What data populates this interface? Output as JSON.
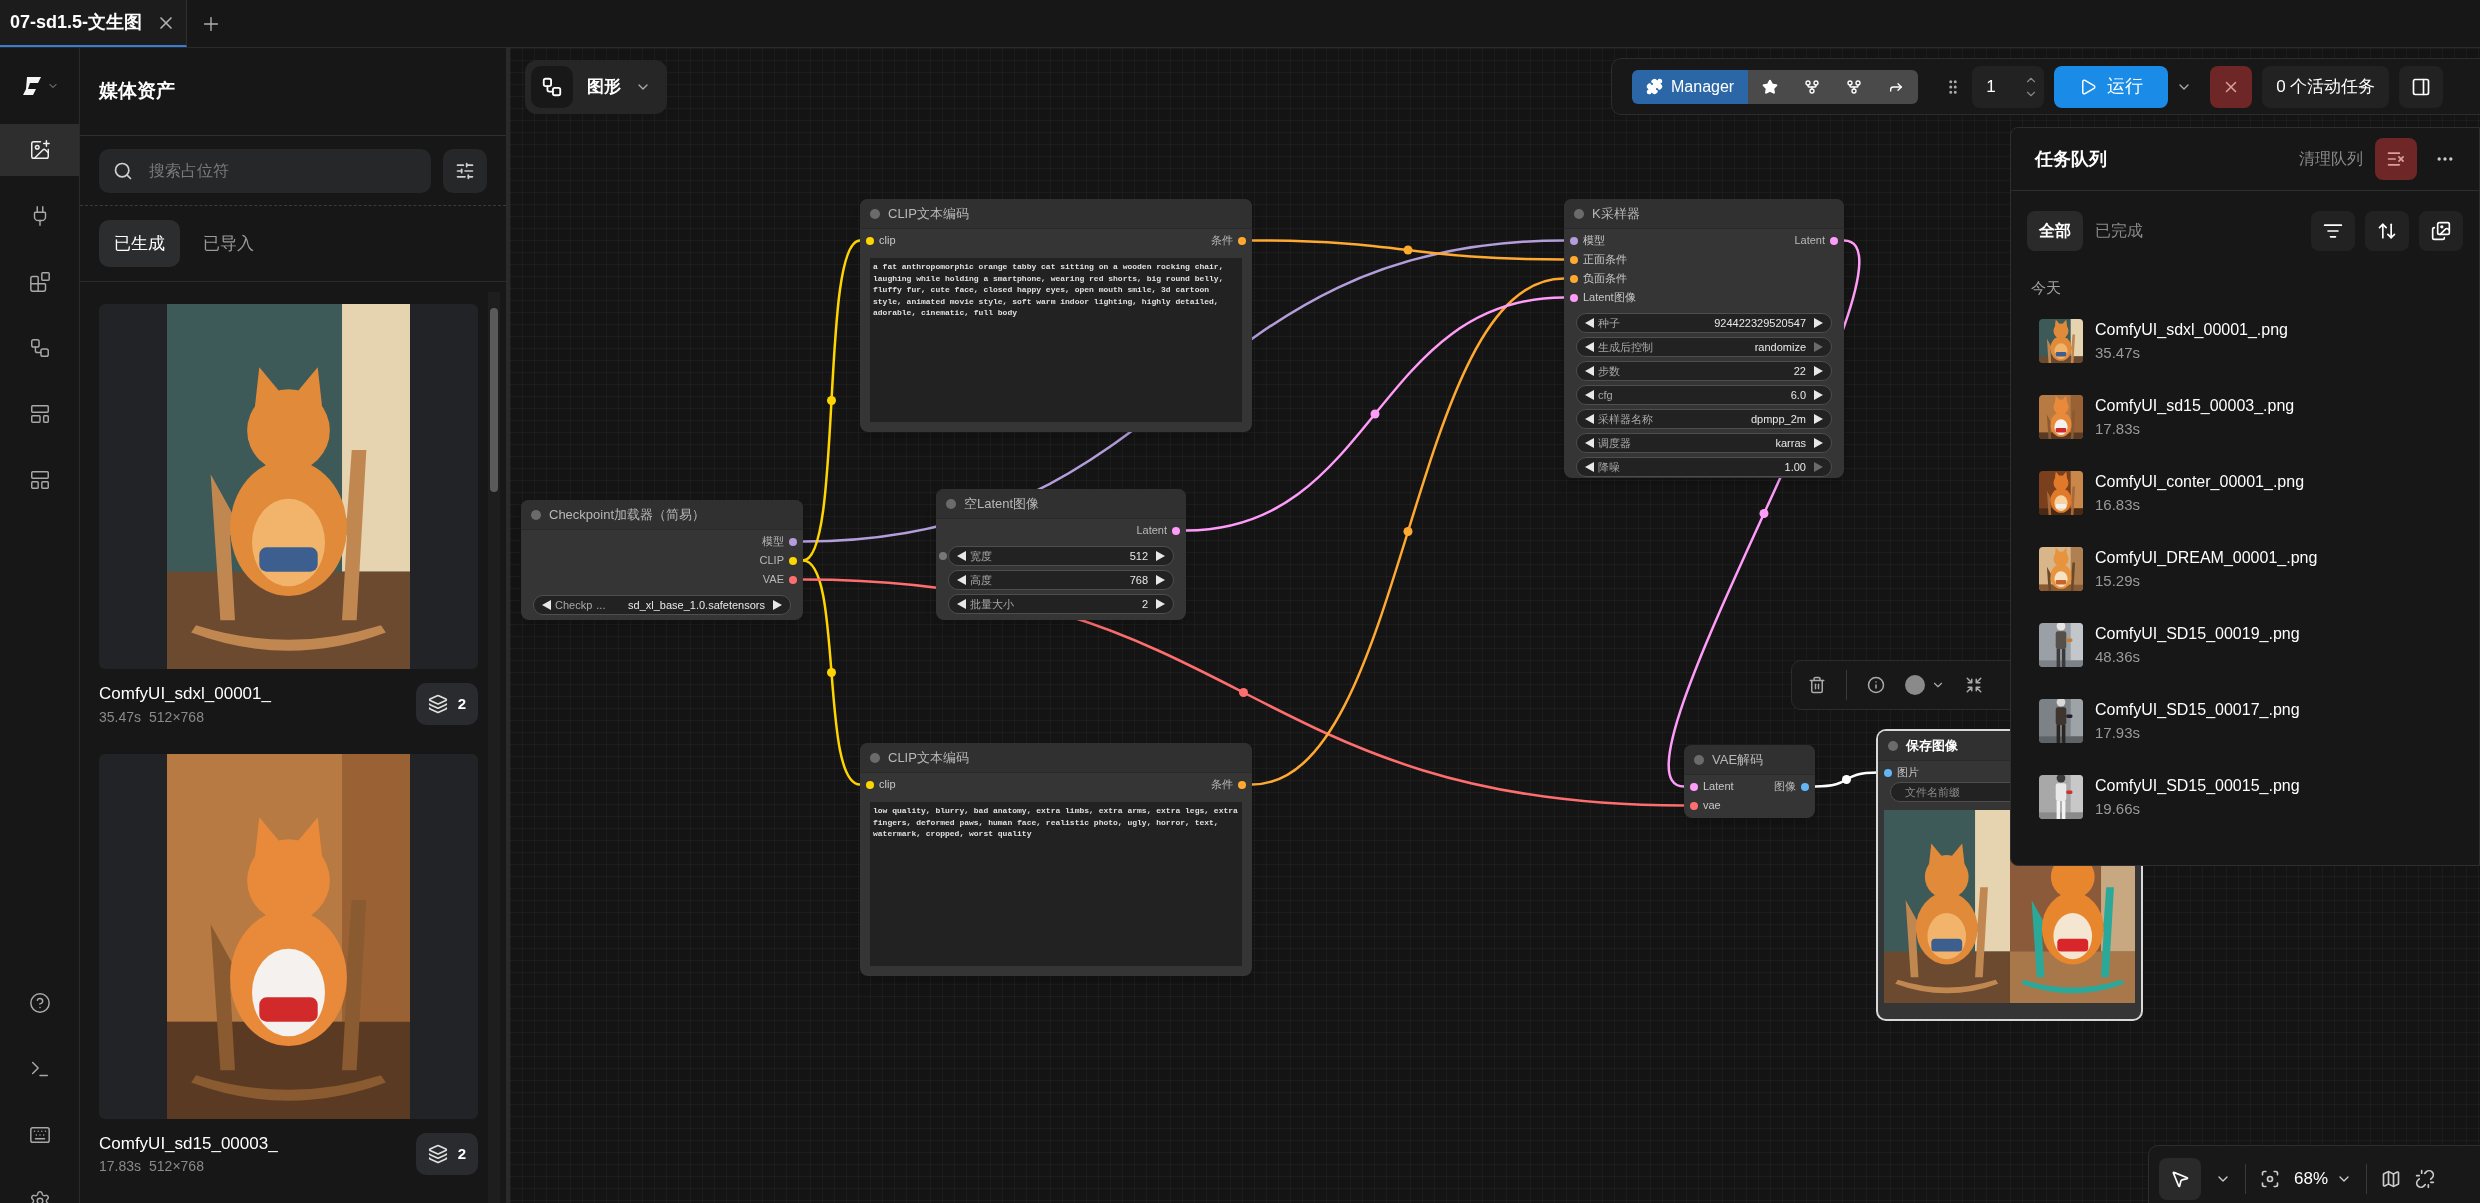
{
  "tabs": [
    {
      "label": "07-sd1.5-文生图",
      "selected": true
    }
  ],
  "rail": {
    "top": [
      {
        "kind": "media",
        "selected": true
      },
      {
        "kind": "nodes",
        "selected": false
      },
      {
        "kind": "models",
        "selected": false
      },
      {
        "kind": "workflows",
        "selected": false
      },
      {
        "kind": "templates",
        "selected": false
      },
      {
        "kind": "layouts",
        "selected": false
      }
    ],
    "bottom": [
      {
        "kind": "help"
      },
      {
        "kind": "terminal"
      },
      {
        "kind": "shortcuts"
      },
      {
        "kind": "settings"
      }
    ]
  },
  "media_panel": {
    "title": "媒体资产",
    "search": {
      "placeholder": "搜索占位符"
    },
    "tabs": [
      {
        "label": "已生成",
        "selected": true
      },
      {
        "label": "已导入",
        "selected": false
      }
    ],
    "items": [
      {
        "name": "ComfyUI_sdxl_00001_",
        "duration": "35.47s",
        "size": "512×768",
        "count": "2"
      },
      {
        "name": "ComfyUI_sd15_00003_",
        "duration": "17.83s",
        "size": "512×768",
        "count": "2"
      }
    ]
  },
  "canvas": {
    "mode_button": "图形",
    "nodes": [
      {
        "title": "CLIP文本编码",
        "selected": false,
        "inputs": [
          {
            "label": "clip",
            "color": "#ffd500"
          }
        ],
        "outputs": [
          {
            "label": "条件",
            "color": "#ffa931"
          }
        ],
        "widgets": [
          {
            "kind": "text",
            "value": "a fat anthropomorphic orange tabby cat sitting on a wooden rocking chair, laughing while holding a smartphone, wearing red shorts, big round belly, fluffy fur, cute face, closed happy eyes, open mouth smile, 3d cartoon style, animated movie style, soft warm indoor lighting, highly detailed, adorable, cinematic, full body"
          }
        ]
      },
      {
        "title": "Checkpoint加载器（简易）",
        "selected": false,
        "outputs": [
          {
            "label": "模型",
            "color": "#b39ddb"
          },
          {
            "label": "CLIP",
            "color": "#ffd500"
          },
          {
            "label": "VAE",
            "color": "#ff6e6e"
          }
        ],
        "widgets": [
          {
            "kind": "value",
            "label": "Checkp",
            "elided": "...",
            "value": "sd_xl_base_1.0.safetensors",
            "right_disabled": false
          }
        ]
      },
      {
        "title": "空Latent图像",
        "selected": false,
        "outputs": [
          {
            "label": "Latent",
            "color": "#ff9cf9"
          }
        ],
        "widgets": [
          {
            "kind": "value",
            "label": "宽度",
            "value": "512",
            "right_disabled": false,
            "linked_input": true
          },
          {
            "kind": "value",
            "label": "高度",
            "value": "768",
            "right_disabled": false
          },
          {
            "kind": "value",
            "label": "批量大小",
            "value": "2",
            "right_disabled": false
          }
        ]
      },
      {
        "title": "K采样器",
        "selected": false,
        "inputs": [
          {
            "label": "模型",
            "color": "#b39ddb"
          },
          {
            "label": "正面条件",
            "color": "#ffa931"
          },
          {
            "label": "负面条件",
            "color": "#ffa931"
          },
          {
            "label": "Latent图像",
            "color": "#ff9cf9"
          }
        ],
        "outputs": [
          {
            "label": "Latent",
            "color": "#ff9cf9"
          }
        ],
        "widgets": [
          {
            "kind": "value",
            "label": "种子",
            "value": "924422329520547",
            "right_disabled": false
          },
          {
            "kind": "value",
            "label": "生成后控制",
            "value": "randomize",
            "right_disabled": true
          },
          {
            "kind": "value",
            "label": "步数",
            "value": "22",
            "right_disabled": false
          },
          {
            "kind": "value",
            "label": "cfg",
            "value": "6.0",
            "right_disabled": false
          },
          {
            "kind": "value",
            "label": "采样器名称",
            "value": "dpmpp_2m",
            "right_disabled": false
          },
          {
            "kind": "value",
            "label": "调度器",
            "value": "karras",
            "right_disabled": false
          },
          {
            "kind": "value",
            "label": "降噪",
            "value": "1.00",
            "right_disabled": true
          }
        ]
      },
      {
        "title": "CLIP文本编码",
        "selected": false,
        "inputs": [
          {
            "label": "clip",
            "color": "#ffd500"
          }
        ],
        "outputs": [
          {
            "label": "条件",
            "color": "#ffa931"
          }
        ],
        "widgets": [
          {
            "kind": "text",
            "value": "low quality, blurry, bad anatomy, extra limbs, extra arms, extra legs, extra fingers, deformed paws, human face, realistic photo, ugly, horror, text, watermark, cropped, worst quality"
          }
        ]
      },
      {
        "title": "VAE解码",
        "selected": false,
        "inputs": [
          {
            "label": "Latent",
            "color": "#ff9cf9"
          },
          {
            "label": "vae",
            "color": "#ff6e6e"
          }
        ],
        "outputs": [
          {
            "label": "图像",
            "color": "#64b5f6"
          }
        ]
      },
      {
        "title": "保存图像",
        "selected": true,
        "inputs": [
          {
            "label": "图片",
            "color": "#64b5f6"
          }
        ],
        "widgets": [
          {
            "kind": "field",
            "placeholder": "文件名前缀"
          },
          {
            "kind": "preview"
          }
        ]
      }
    ],
    "links": [
      {
        "color": "#b39ddb"
      },
      {
        "color": "#ffd500"
      },
      {
        "color": "#ffd500"
      },
      {
        "color": "#ff6e6e"
      },
      {
        "color": "#ffa931"
      },
      {
        "color": "#ffa931"
      },
      {
        "color": "#ff9cf9"
      },
      {
        "color": "#ff9cf9"
      },
      {
        "color": "#ffffff"
      }
    ]
  },
  "toolbar": {
    "manager": "Manager",
    "batch_count": "1",
    "run": "运行",
    "active_tasks": "0 个活动任务"
  },
  "queue": {
    "title": "任务队列",
    "clear": "清理队列",
    "tabs": [
      {
        "label": "全部",
        "selected": true
      },
      {
        "label": "已完成",
        "selected": false
      }
    ],
    "section": "今天",
    "items": [
      {
        "name": "ComfyUI_sdxl_00001_.png",
        "time": "35.47s"
      },
      {
        "name": "ComfyUI_sd15_00003_.png",
        "time": "17.83s"
      },
      {
        "name": "ComfyUI_conter_00001_.png",
        "time": "16.83s"
      },
      {
        "name": "ComfyUI_DREAM_00001_.png",
        "time": "15.29s"
      },
      {
        "name": "ComfyUI_SD15_00019_.png",
        "time": "48.36s"
      },
      {
        "name": "ComfyUI_SD15_00017_.png",
        "time": "17.93s"
      },
      {
        "name": "ComfyUI_SD15_00015_.png",
        "time": "19.66s"
      }
    ]
  },
  "zoom": "68%"
}
